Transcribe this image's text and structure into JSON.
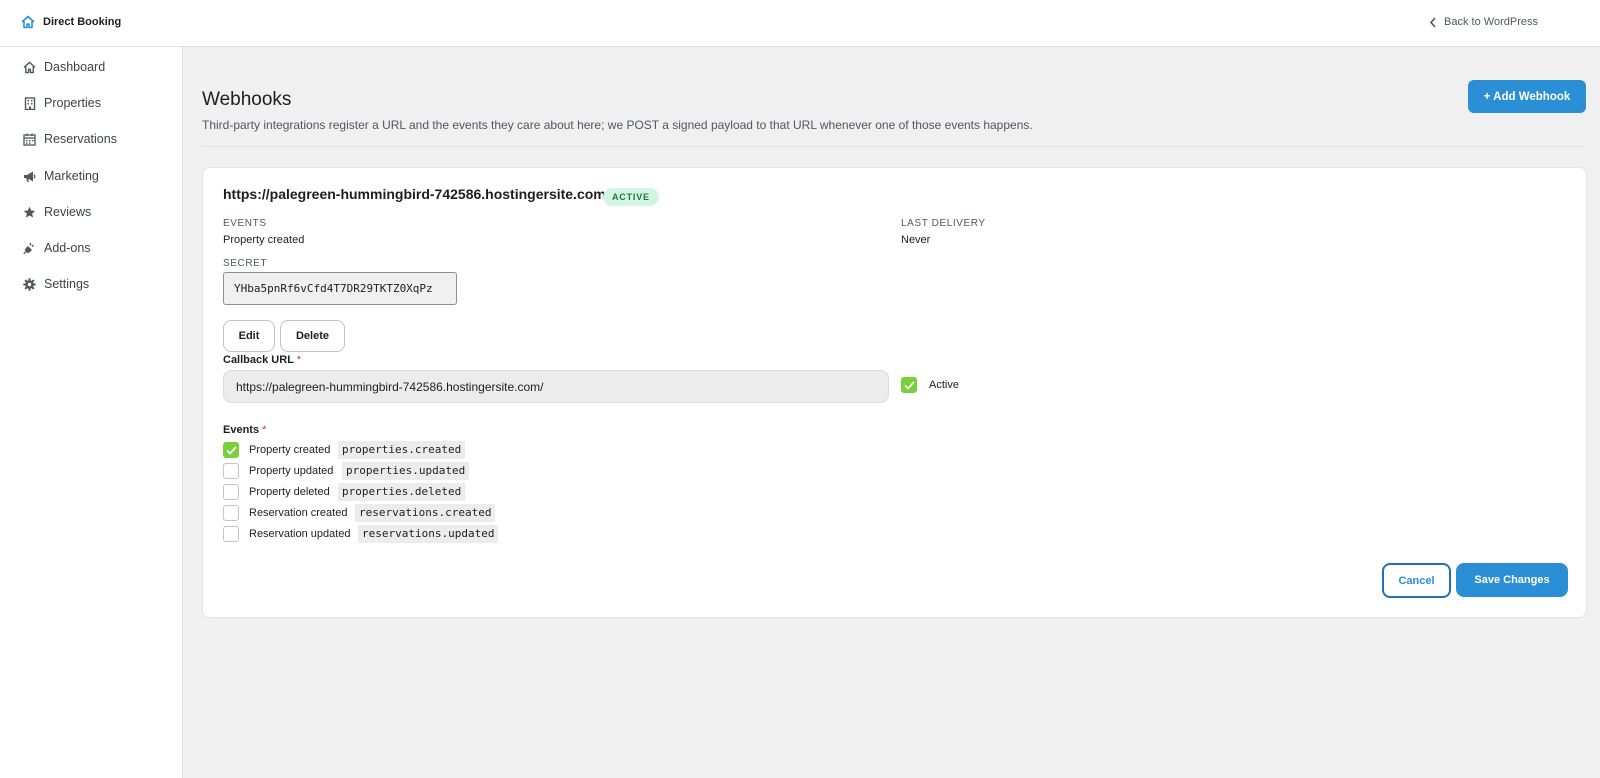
{
  "header": {
    "brand": "Direct Booking",
    "back_link": "Back to WordPress"
  },
  "sidebar": {
    "items": [
      {
        "label": "Dashboard",
        "icon": "house-icon"
      },
      {
        "label": "Properties",
        "icon": "building-icon"
      },
      {
        "label": "Reservations",
        "icon": "calendar-icon"
      },
      {
        "label": "Marketing",
        "icon": "megaphone-icon"
      },
      {
        "label": "Reviews",
        "icon": "star-icon"
      },
      {
        "label": "Add-ons",
        "icon": "plug-icon"
      },
      {
        "label": "Settings",
        "icon": "gear-icon"
      }
    ]
  },
  "page": {
    "title": "Webhooks",
    "description": "Third-party integrations register a URL and the events they care about here; we POST a signed payload to that URL whenever one of those events happens.",
    "add_button": "+ Add Webhook"
  },
  "webhook": {
    "url": "https://palegreen-hummingbird-742586.hostingersite.com/",
    "status_badge": "ACTIVE",
    "events_label": "EVENTS",
    "events_value": "Property created",
    "last_delivery_label": "LAST DELIVERY",
    "last_delivery_value": "Never",
    "secret_label": "SECRET",
    "secret_value": "YHba5pnRf6vCfd4T7DR29TKTZ0XqPz",
    "edit_button": "Edit",
    "delete_button": "Delete"
  },
  "form": {
    "callback_label": "Callback URL",
    "required_mark": "*",
    "callback_value": "https://palegreen-hummingbird-742586.hostingersite.com/",
    "active_label": "Active",
    "active_checked": true,
    "events_label": "Events",
    "events": [
      {
        "label": "Property created",
        "code": "properties.created",
        "checked": true
      },
      {
        "label": "Property updated",
        "code": "properties.updated",
        "checked": false
      },
      {
        "label": "Property deleted",
        "code": "properties.deleted",
        "checked": false
      },
      {
        "label": "Reservation created",
        "code": "reservations.created",
        "checked": false
      },
      {
        "label": "Reservation updated",
        "code": "reservations.updated",
        "checked": false
      }
    ],
    "cancel_button": "Cancel",
    "save_button": "Save Changes"
  },
  "colors": {
    "accent": "#2b8fd6",
    "check": "#7ad03a",
    "badge_bg": "#d5f5e3",
    "badge_text": "#1a7a43"
  }
}
